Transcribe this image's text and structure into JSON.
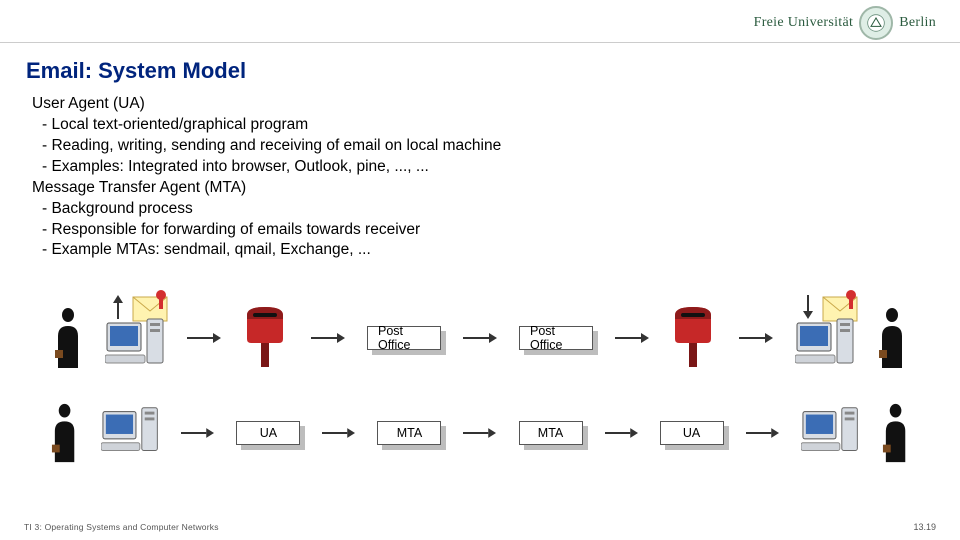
{
  "header": {
    "logo_text": "Freie Universität",
    "logo_sub": "Berlin"
  },
  "title": "Email: System Model",
  "content": {
    "ua_head": "User Agent (UA)",
    "ua_b1": "Local text-oriented/graphical program",
    "ua_b2": "Reading, writing, sending and receiving of email on local machine",
    "ua_b3": "Examples: Integrated into browser, Outlook, pine, ..., ...",
    "mta_head": "Message Transfer Agent (MTA)",
    "mta_b1": "Background process",
    "mta_b2": "Responsible for forwarding of emails towards receiver",
    "mta_b3": "Example MTAs: sendmail, qmail, Exchange, ..."
  },
  "diagram": {
    "post_office": "Post Office",
    "ua": "UA",
    "mta": "MTA"
  },
  "footer": {
    "left": "TI 3: Operating Systems and Computer Networks",
    "right": "13.19"
  }
}
